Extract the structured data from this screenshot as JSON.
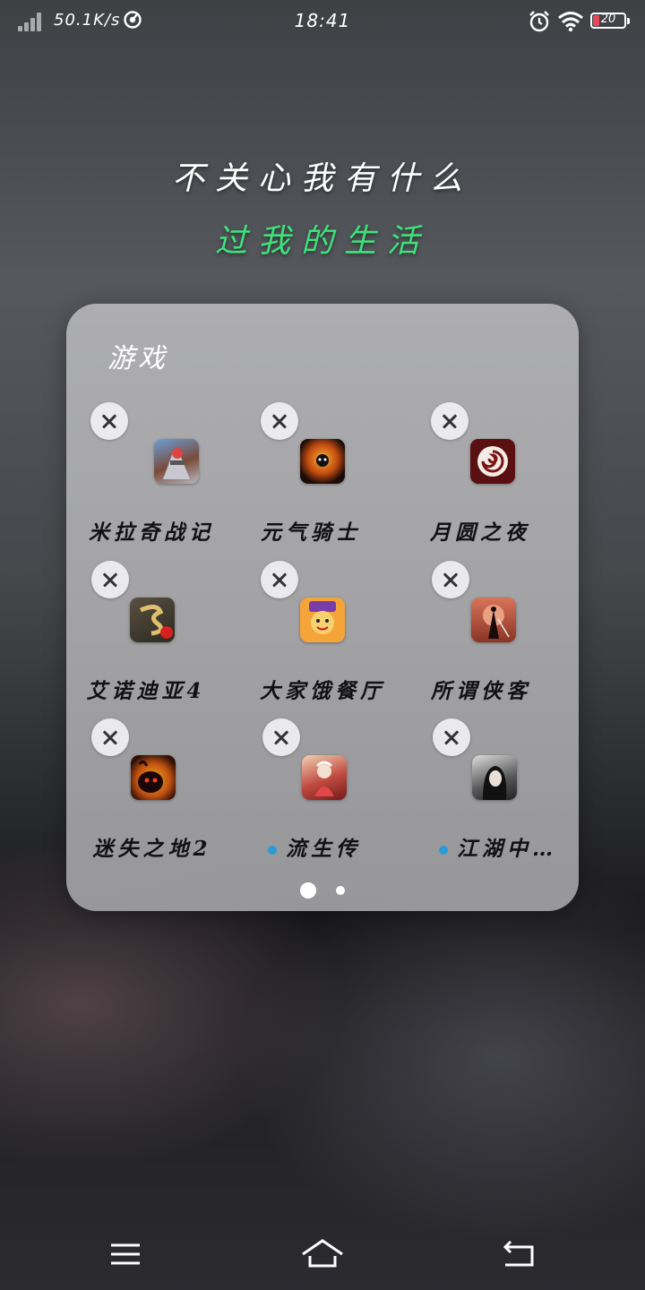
{
  "status_bar": {
    "net_speed": "50.1K/s",
    "time": "18:41",
    "battery": "20",
    "battery_level_percent": 20,
    "icons": [
      "signal-icon",
      "speed-meter-icon",
      "alarm-icon",
      "wifi-icon",
      "battery-icon"
    ]
  },
  "wallpaper": {
    "line1": "不关心我有什么",
    "line2": "过我的生活",
    "line2_color": "#3fe27a"
  },
  "folder": {
    "title": "游戏",
    "apps": [
      {
        "label": "米拉奇战记",
        "new": false,
        "icon": "warrior-game-icon"
      },
      {
        "label": "元气骑士",
        "new": false,
        "icon": "soul-knight-icon"
      },
      {
        "label": "月圆之夜",
        "new": false,
        "icon": "moon-swirl-icon"
      },
      {
        "label": "艾诺迪亚4",
        "new": false,
        "icon": "dragon-game-icon"
      },
      {
        "label": "大家饿餐厅",
        "new": false,
        "icon": "cartoon-chef-icon"
      },
      {
        "label": "所谓侠客",
        "new": false,
        "icon": "swordsman-silhouette-icon"
      },
      {
        "label": "迷失之地2",
        "new": false,
        "icon": "shadow-creature-icon"
      },
      {
        "label": "流生传",
        "new": true,
        "icon": "fantasy-hero-icon"
      },
      {
        "label": "江湖中…",
        "new": true,
        "icon": "jianghu-portrait-icon"
      }
    ],
    "page_count": 2,
    "current_page": 1
  },
  "nav_bar": {
    "icons": [
      "menu-icon",
      "home-icon",
      "back-icon"
    ]
  }
}
